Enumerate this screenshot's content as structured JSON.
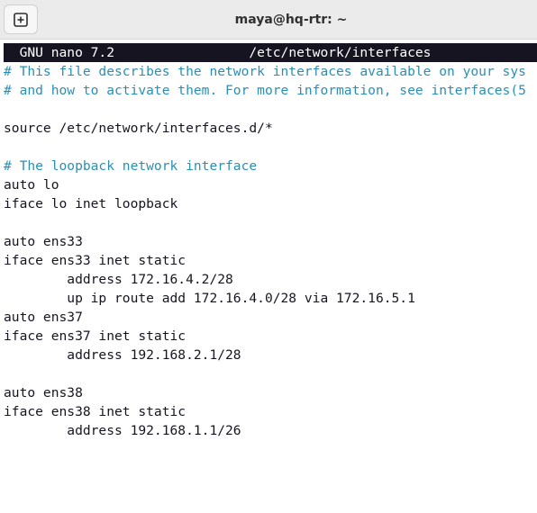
{
  "window": {
    "title": "maya@hq-rtr: ~"
  },
  "toolbar": {
    "new_tab_icon": "plus-box-icon"
  },
  "nano": {
    "header_left": "  GNU nano 7.2",
    "header_right": "/etc/network/interfaces",
    "lines": [
      {
        "text": "# This file describes the network interfaces available on your sys",
        "kind": "comment"
      },
      {
        "text": "# and how to activate them. For more information, see interfaces(5",
        "kind": "comment"
      },
      {
        "text": "",
        "kind": "text"
      },
      {
        "text": "source /etc/network/interfaces.d/*",
        "kind": "text"
      },
      {
        "text": "",
        "kind": "text"
      },
      {
        "text": "# The loopback network interface",
        "kind": "comment"
      },
      {
        "text": "auto lo",
        "kind": "text"
      },
      {
        "text": "iface lo inet loopback",
        "kind": "text"
      },
      {
        "text": "",
        "kind": "text"
      },
      {
        "text": "auto ens33",
        "kind": "text"
      },
      {
        "text": "iface ens33 inet static",
        "kind": "text"
      },
      {
        "text": "        address 172.16.4.2/28",
        "kind": "text"
      },
      {
        "text": "        up ip route add 172.16.4.0/28 via 172.16.5.1",
        "kind": "text"
      },
      {
        "text": "auto ens37",
        "kind": "text"
      },
      {
        "text": "iface ens37 inet static",
        "kind": "text"
      },
      {
        "text": "        address 192.168.2.1/28",
        "kind": "text"
      },
      {
        "text": "",
        "kind": "text"
      },
      {
        "text": "auto ens38",
        "kind": "text"
      },
      {
        "text": "iface ens38 inet static",
        "kind": "text"
      },
      {
        "text": "        address 192.168.1.1/26",
        "kind": "text"
      }
    ]
  },
  "colors": {
    "comment": "#2a8fb4",
    "text": "#171421",
    "header_bg": "#171421",
    "header_fg": "#ffffff",
    "titlebar_bg": "#ebebeb"
  }
}
